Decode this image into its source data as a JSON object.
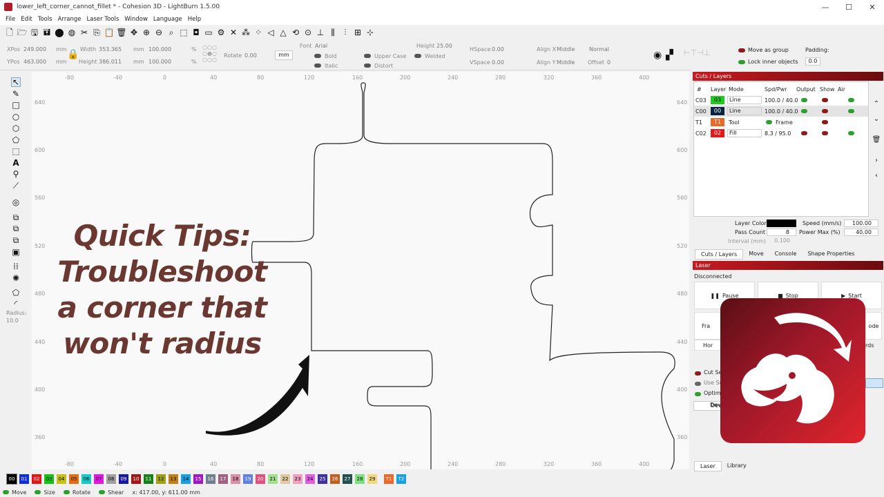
{
  "window": {
    "title": "lower_left_corner_cannot_fillet * - Cohesion 3D - LightBurn 1.5.00",
    "controls": [
      "—",
      "☐",
      "✕"
    ]
  },
  "menu": [
    "File",
    "Edit",
    "Tools",
    "Arrange",
    "Laser Tools",
    "Window",
    "Language",
    "Help"
  ],
  "props": {
    "xpos_label": "XPos",
    "xpos": "249.000",
    "ypos_label": "YPos",
    "ypos": "463.000",
    "unit": "mm",
    "width_label": "Width",
    "width": "353.365",
    "height_label": "Height",
    "height": "386.011",
    "wpct": "100.000",
    "hpct": "100.000",
    "pct": "%",
    "rotate_label": "Rotate",
    "rotate": "0.00",
    "mm_button": "mm",
    "font_label": "Font",
    "font": "Arial",
    "fheight_label": "Height",
    "fheight": "25.00",
    "bold": "Bold",
    "italic": "Italic",
    "upper": "Upper Case",
    "distort": "Distort",
    "welded": "Welded",
    "hspace_label": "HSpace",
    "hspace": "0.00",
    "vspace_label": "VSpace",
    "vspace": "0.00",
    "alignx_label": "Align X",
    "alignx": "Middle",
    "aligny_label": "Align Y",
    "aligny": "Middle",
    "mode": "Normal",
    "offset_label": "Offset",
    "offset": "0",
    "move_group": "Move as group",
    "lock_inner": "Lock inner objects",
    "padding_label": "Padding:",
    "padding": "0.0"
  },
  "ruler": {
    "top": [
      "-80",
      "-40",
      "0",
      "40",
      "80",
      "120",
      "160",
      "200",
      "240",
      "280",
      "320",
      "360",
      "400"
    ],
    "left": [
      "640",
      "600",
      "560",
      "520",
      "480",
      "440",
      "400",
      "360"
    ],
    "right": [
      "640",
      "600",
      "560",
      "520",
      "480",
      "440",
      "400",
      "360"
    ]
  },
  "tool_radius": {
    "label": "Radius:",
    "value": "10.0"
  },
  "overlay": {
    "lines": [
      "Quick Tips:",
      "Troubleshoot",
      "a corner that",
      "won't radius"
    ]
  },
  "cuts_panel": {
    "title": "Cuts / Layers",
    "headers": [
      "#",
      "Layer",
      "Mode",
      "Spd/Pwr",
      "Output",
      "Show",
      "Air"
    ],
    "rows": [
      {
        "id": "C03",
        "layer": "03",
        "color": "#1fcb1f",
        "mode": "Line",
        "spdpwr": "100.0 / 40.0"
      },
      {
        "id": "C00",
        "layer": "00",
        "color": "#0a2340",
        "mode": "Line",
        "spdpwr": "100.0 / 40.0"
      },
      {
        "id": "T1",
        "layer": "T1",
        "color": "#e8692a",
        "mode": "Tool",
        "spdpwr": "Frame"
      },
      {
        "id": "C02",
        "layer": "02",
        "color": "#e81818",
        "mode": "Fill",
        "spdpwr": "8.3 / 95.0"
      }
    ],
    "layer_color_label": "Layer Color",
    "speed_label": "Speed (mm/s)",
    "speed": "100.00",
    "pass_label": "Pass Count",
    "pass": "8",
    "power_label": "Power Max (%)",
    "power": "40.00",
    "interval_label": "Interval (mm)",
    "interval": "0.100",
    "tabs": [
      "Cuts / Layers",
      "Move",
      "Console",
      "Shape Properties"
    ]
  },
  "laser_panel": {
    "title": "Laser",
    "status": "Disconnected",
    "pause": "Pause",
    "stop": "Stop",
    "start": "Start",
    "frame": "Fra",
    "mode": "ode",
    "home": "Hor",
    "coords": "rds",
    "cut_sel": "Cut Se",
    "use_sel": "Use Se",
    "optim": "Optim",
    "devices": "Devices",
    "tabs": [
      "Laser",
      "Library"
    ]
  },
  "palette": [
    {
      "label": "00",
      "color": "#000000"
    },
    {
      "label": "01",
      "color": "#1030d8"
    },
    {
      "label": "02",
      "color": "#e01818"
    },
    {
      "label": "03",
      "color": "#18c018"
    },
    {
      "label": "04",
      "color": "#c8c018"
    },
    {
      "label": "05",
      "color": "#e07018"
    },
    {
      "label": "06",
      "color": "#18c8c8"
    },
    {
      "label": "07",
      "color": "#e018e0"
    },
    {
      "label": "08",
      "color": "#a0a0a0"
    },
    {
      "label": "09",
      "color": "#1818a0"
    },
    {
      "label": "10",
      "color": "#a01818"
    },
    {
      "label": "11",
      "color": "#188018"
    },
    {
      "label": "12",
      "color": "#a0a018"
    },
    {
      "label": "13",
      "color": "#c08018"
    },
    {
      "label": "14",
      "color": "#18a0e0"
    },
    {
      "label": "15",
      "color": "#a018c0"
    },
    {
      "label": "16",
      "color": "#708090"
    },
    {
      "label": "17",
      "color": "#a06080"
    },
    {
      "label": "18",
      "color": "#d890a8"
    },
    {
      "label": "19",
      "color": "#6080e0"
    },
    {
      "label": "20",
      "color": "#e05080"
    },
    {
      "label": "21",
      "color": "#a0e090"
    },
    {
      "label": "22",
      "color": "#e0c8a0"
    },
    {
      "label": "23",
      "color": "#f0a0c0"
    },
    {
      "label": "24",
      "color": "#e060e0"
    },
    {
      "label": "25",
      "color": "#4030a0"
    },
    {
      "label": "26",
      "color": "#c06020"
    },
    {
      "label": "27",
      "color": "#205050"
    },
    {
      "label": "28",
      "color": "#80e080"
    },
    {
      "label": "29",
      "color": "#f0d880"
    },
    {
      "label": "T1",
      "color": "#e8692a"
    },
    {
      "label": "T2",
      "color": "#18a0e0"
    }
  ],
  "status": {
    "move": "Move",
    "size": "Size",
    "rotate": "Rotate",
    "shear": "Shear",
    "coords": "x: 417.00, y: 611.00 mm"
  }
}
